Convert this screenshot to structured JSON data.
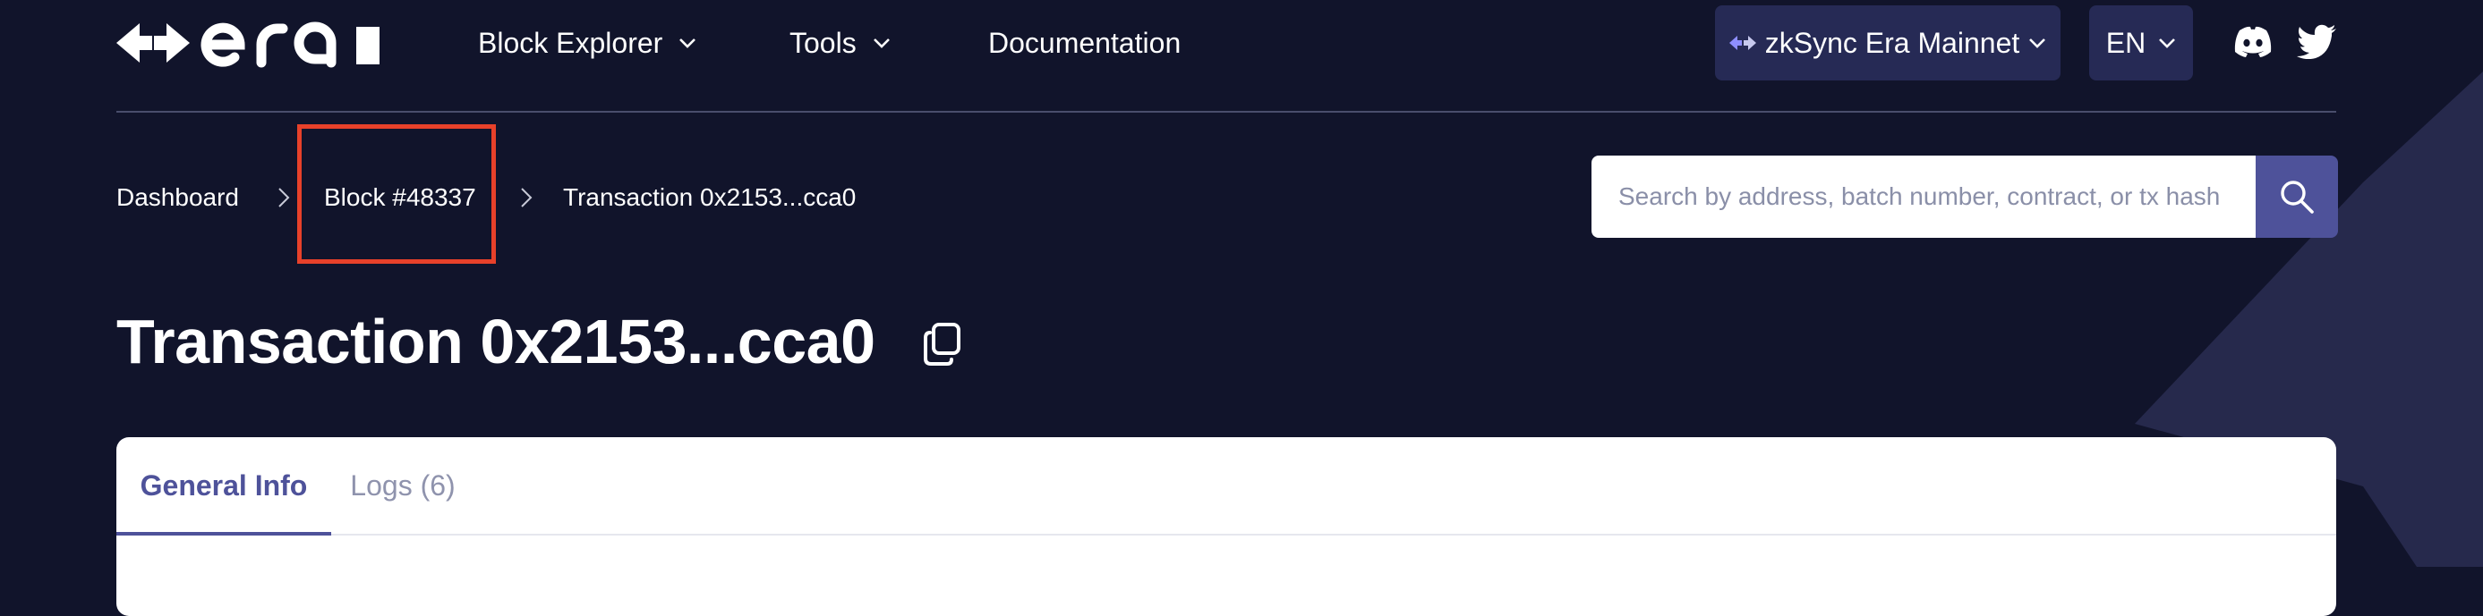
{
  "header": {
    "logo_alt": "era",
    "nav": [
      {
        "label": "Block Explorer",
        "has_dropdown": true
      },
      {
        "label": "Tools",
        "has_dropdown": true
      },
      {
        "label": "Documentation",
        "has_dropdown": false
      }
    ],
    "network": {
      "label": "zkSync Era Mainnet",
      "icon": "zksync-arrows-icon"
    },
    "language": {
      "label": "EN"
    },
    "social": [
      {
        "icon": "discord-icon"
      },
      {
        "icon": "twitter-icon"
      }
    ]
  },
  "breadcrumb": [
    {
      "label": "Dashboard"
    },
    {
      "label": "Block #48337",
      "highlighted": true
    },
    {
      "label": "Transaction 0x2153...cca0"
    }
  ],
  "search": {
    "placeholder": "Search by address, batch number, contract, or tx hash",
    "value": "",
    "button_icon": "search-icon"
  },
  "page": {
    "title": "Transaction 0x2153...cca0",
    "copy_icon": "copy-icon"
  },
  "tabs": [
    {
      "label": "General Info",
      "active": true
    },
    {
      "label": "Logs (6)",
      "active": false
    }
  ],
  "colors": {
    "background": "#11142b",
    "accent": "#4e529a",
    "button_bg": "#262a55",
    "highlight": "#e8412a"
  }
}
